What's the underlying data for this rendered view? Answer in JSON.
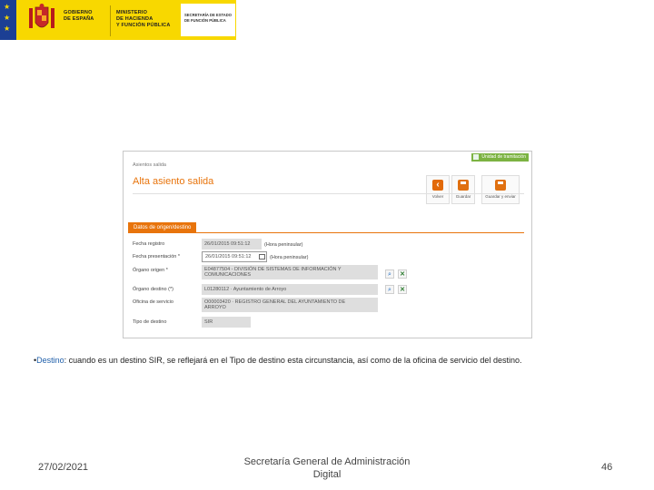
{
  "header": {
    "government_lines": [
      "GOBIERNO",
      "DE ESPAÑA"
    ],
    "ministry_lines": [
      "MINISTERIO",
      "DE HACIENDA",
      "Y FUNCIÓN PÚBLICA"
    ],
    "secretariat_lines": [
      "SECRETARÍA DE ESTADO",
      "DE FUNCIÓN PÚBLICA"
    ],
    "colors": {
      "banner": "#f8d800",
      "eu_blue": "#1c3f94"
    }
  },
  "app": {
    "help_link": "Unidad de tramitación",
    "breadcrumb": "Asientos salida",
    "title": "Alta asiento salida",
    "toolbar": {
      "back": "Volver",
      "save": "Guardar",
      "save_send": "Guardar y enviar"
    },
    "section_tab": "Datos de origen/destino",
    "fields": {
      "fecha_registro": {
        "label": "Fecha registro",
        "value": "26/01/2015 09:51:12",
        "note": "(Hora peninsular)"
      },
      "fecha_presentacion": {
        "label": "Fecha presentación *",
        "value": "26/01/2015 09:51:12",
        "note": "(Hora peninsular)"
      },
      "organo_origen": {
        "label": "Órgano origen *",
        "value_line1": "E04877504 - DIVISIÓN DE SISTEMAS DE INFORMACIÓN Y",
        "value_line2": "COMUNICACIONES"
      },
      "organo_destino": {
        "label": "Órgano destino (*)",
        "value": "L01280112 · Ayuntamiento de Arroyo"
      },
      "oficina_servicio": {
        "label": "Oficina de servicio",
        "value_line1": "O00003420 · REGISTRO GENERAL DEL AYUNTAMIENTO DE",
        "value_line2": "ARROYO"
      },
      "tipo_destino": {
        "label": "Tipo de destino",
        "value": "SIR"
      }
    },
    "accent": "#e8740c"
  },
  "caption": {
    "bullet": "•",
    "keyword": "Destino",
    "text": ": cuando es un destino SIR, se reflejará en el Tipo de destino esta circunstancia, así como de la oficina de servicio del destino."
  },
  "footer": {
    "date": "27/02/2021",
    "center_line1": "Secretaría General de Administración",
    "center_line2": "Digital",
    "page": "46"
  }
}
